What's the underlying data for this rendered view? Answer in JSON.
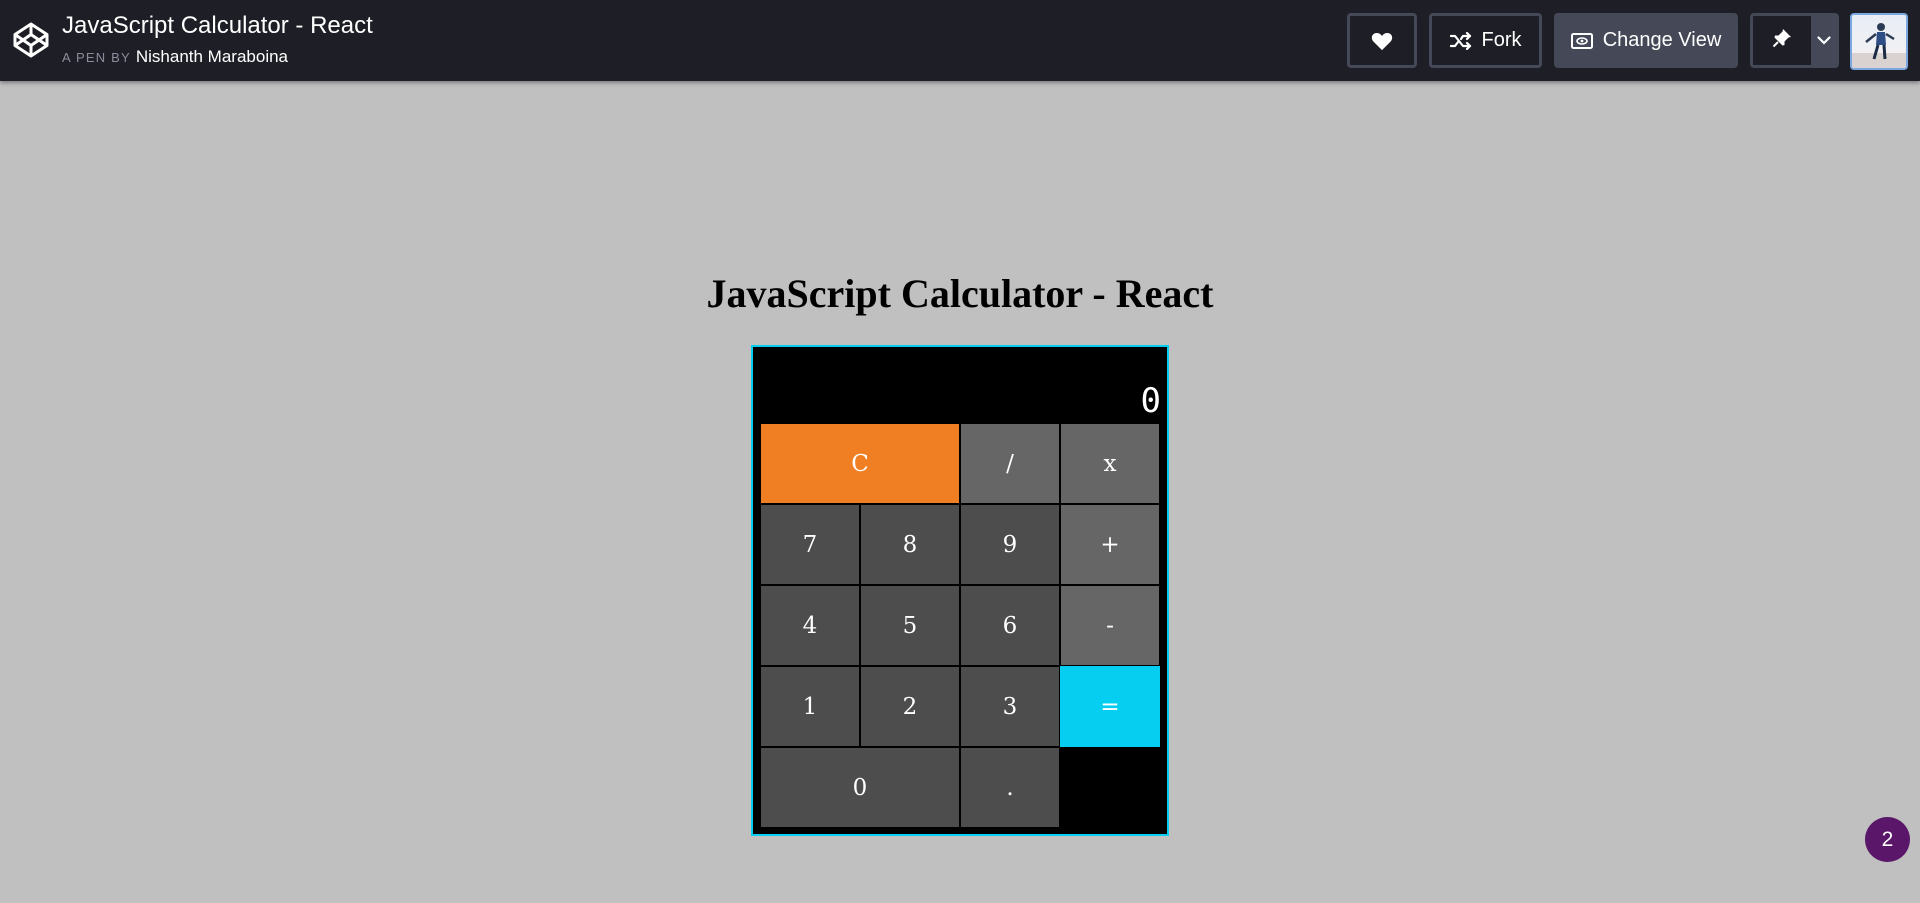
{
  "header": {
    "title": "JavaScript Calculator - React",
    "byline_prefix": "A PEN BY",
    "author": "Nishanth Maraboina",
    "fork_label": "Fork",
    "change_view_label": "Change View"
  },
  "app": {
    "title": "JavaScript Calculator - React",
    "display": {
      "formula": "",
      "current": "0"
    },
    "keys": {
      "clear": "C",
      "divide": "/",
      "multiply": "x",
      "seven": "7",
      "eight": "8",
      "nine": "9",
      "add": "+",
      "four": "4",
      "five": "5",
      "six": "6",
      "subtract": "-",
      "one": "1",
      "two": "2",
      "three": "3",
      "equals": "=",
      "zero": "0",
      "decimal": "."
    }
  },
  "badge": {
    "count": "2"
  },
  "colors": {
    "topbar": "#1e1f26",
    "button_border": "#444857",
    "page_bg": "#c0c0c0",
    "clear_key": "#ef7f22",
    "equals_key": "#06cef1",
    "operator_key": "#666666",
    "number_key": "#4d4d4d",
    "badge": "#5a1668"
  },
  "icons": {
    "logo": "codepen-logo-icon",
    "like": "heart-icon",
    "fork": "fork-icon",
    "view": "change-view-icon",
    "pin": "pin-icon",
    "dropdown": "chevron-down-icon"
  }
}
